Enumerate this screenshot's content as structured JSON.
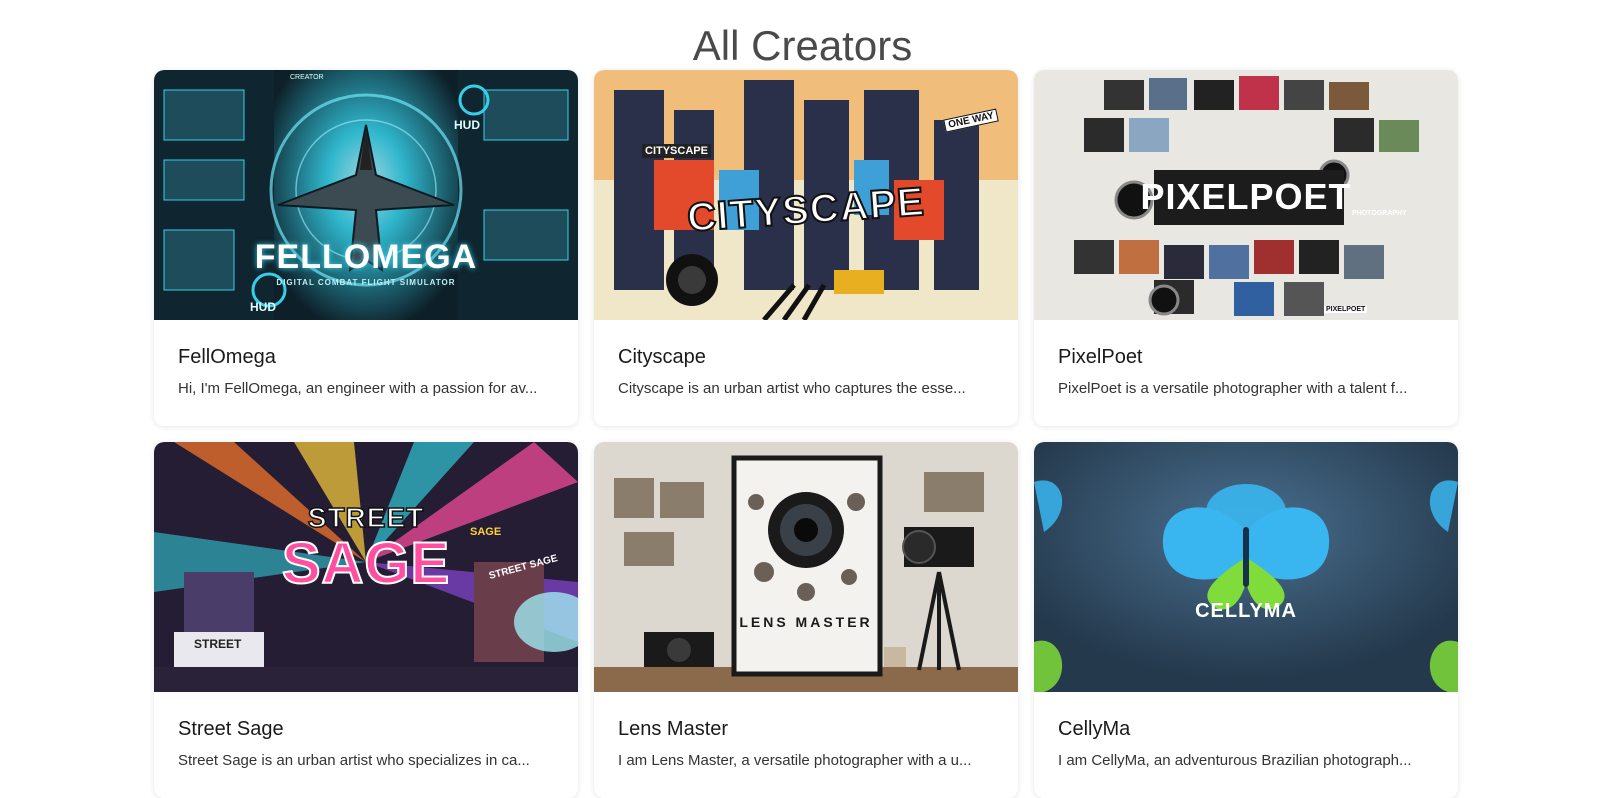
{
  "page": {
    "title": "All Creators"
  },
  "creators": [
    {
      "name": "FellOmega",
      "description": "Hi, I'm FellOmega, an engineer with a passion for av...",
      "banner_text": "FELLOMEGA",
      "banner_sub": "DIGITAL COMBAT FLIGHT SIMULATOR",
      "banner_tags": [
        "HUD",
        "HUD",
        "CREATOR"
      ],
      "colors": {
        "bg": "#0f2530",
        "accent": "#35d0e8",
        "mid": "#1e4c5a"
      }
    },
    {
      "name": "Cityscape",
      "description": "Cityscape is an urban artist who captures the esse...",
      "banner_text": "CITYSCAPE",
      "banner_tags": [
        "CITYSCAPE",
        "ONE WAY"
      ],
      "colors": {
        "bg": "#f0e6c8",
        "accent": "#e24a2b",
        "mid": "#2a2f4a"
      }
    },
    {
      "name": "PixelPoet",
      "description": "PixelPoet is a versatile photographer with a talent f...",
      "banner_text": "PIXELPOET",
      "banner_tags": [
        "PHOTOGRAPHY",
        "PIXELPOET"
      ],
      "colors": {
        "bg": "#e9e7e2",
        "accent": "#c0324a",
        "mid": "#2b2b2b"
      }
    },
    {
      "name": "Street Sage",
      "description": "Street Sage is an urban artist who specializes in ca...",
      "banner_text": "SAGE",
      "banner_top": "STREET",
      "banner_tags": [
        "STREET",
        "SAGE",
        "STREET SAGE"
      ],
      "colors": {
        "bg": "#241d33",
        "accent": "#ff4fa0",
        "mid": "#32c8d6"
      }
    },
    {
      "name": "Lens Master",
      "description": "I am Lens Master, a versatile photographer with a u...",
      "banner_text": "LENS MASTER",
      "colors": {
        "bg": "#dcd8d0",
        "accent": "#1a1a1a",
        "mid": "#8a7d6c"
      }
    },
    {
      "name": "CellyMa",
      "description": "I am CellyMa, an adventurous Brazilian photograph...",
      "banner_text": "CELLYMA",
      "colors": {
        "bg": "#2c4358",
        "accent": "#39b6f0",
        "mid": "#7fdc3a"
      }
    }
  ]
}
